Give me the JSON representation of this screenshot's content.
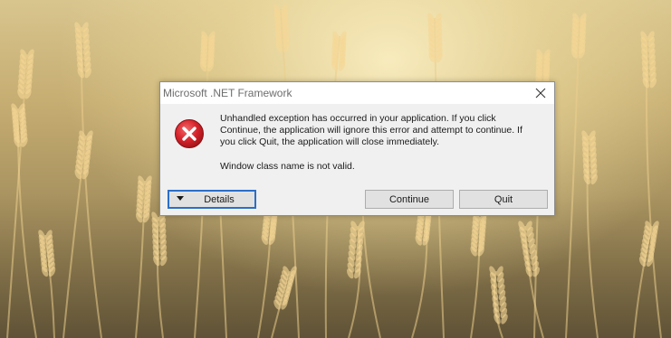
{
  "dialog": {
    "title": "Microsoft .NET Framework",
    "message": "Unhandled exception has occurred in your application. If you click Continue, the application will ignore this error and attempt to continue. If you click Quit, the application will close immediately.",
    "detail": "Window class name is not valid.",
    "icons": {
      "error": "error-icon",
      "close": "close-icon",
      "expand": "caret-down-icon"
    }
  },
  "buttons": {
    "details": "Details",
    "continue": "Continue",
    "quit": "Quit"
  },
  "colors": {
    "dialog_bg": "#f0f0f0",
    "titlebar_bg": "#ffffff",
    "error_red": "#d6232b",
    "focus_blue": "#2b6fc7"
  }
}
